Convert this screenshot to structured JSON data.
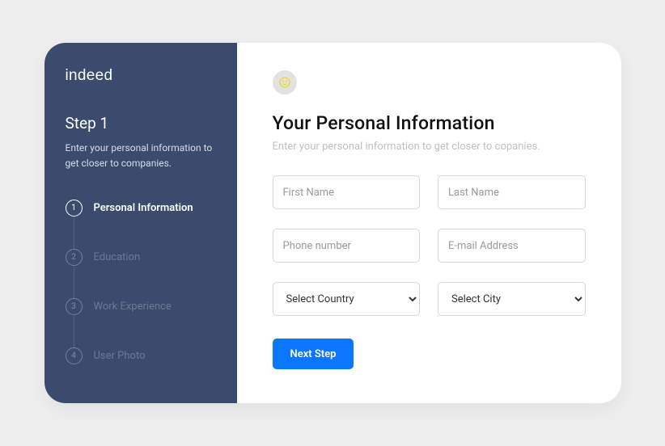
{
  "brand": "indeed",
  "sidebar": {
    "step_title": "Step 1",
    "step_desc": "Enter your personal information to get closer to companies.",
    "steps": [
      {
        "num": "1",
        "label": "Personal Information",
        "active": true
      },
      {
        "num": "2",
        "label": "Education",
        "active": false
      },
      {
        "num": "3",
        "label": "Work Experience",
        "active": false
      },
      {
        "num": "4",
        "label": "User Photo",
        "active": false
      }
    ]
  },
  "main": {
    "title": "Your Personal Information",
    "desc": "Enter your personal information to get closer to copanies.",
    "fields": {
      "first_name": {
        "placeholder": "First Name",
        "value": ""
      },
      "last_name": {
        "placeholder": "Last Name",
        "value": ""
      },
      "phone": {
        "placeholder": "Phone number",
        "value": ""
      },
      "email": {
        "placeholder": "E-mail Address",
        "value": ""
      },
      "country": {
        "selected": "Select Country"
      },
      "city": {
        "selected": "Select City"
      }
    },
    "button": "Next Step"
  },
  "icons": {
    "badge": "smile-icon"
  },
  "colors": {
    "sidebar_bg": "#3a4b6d",
    "accent": "#0b76ff",
    "icon_accent": "#e7d93a"
  }
}
